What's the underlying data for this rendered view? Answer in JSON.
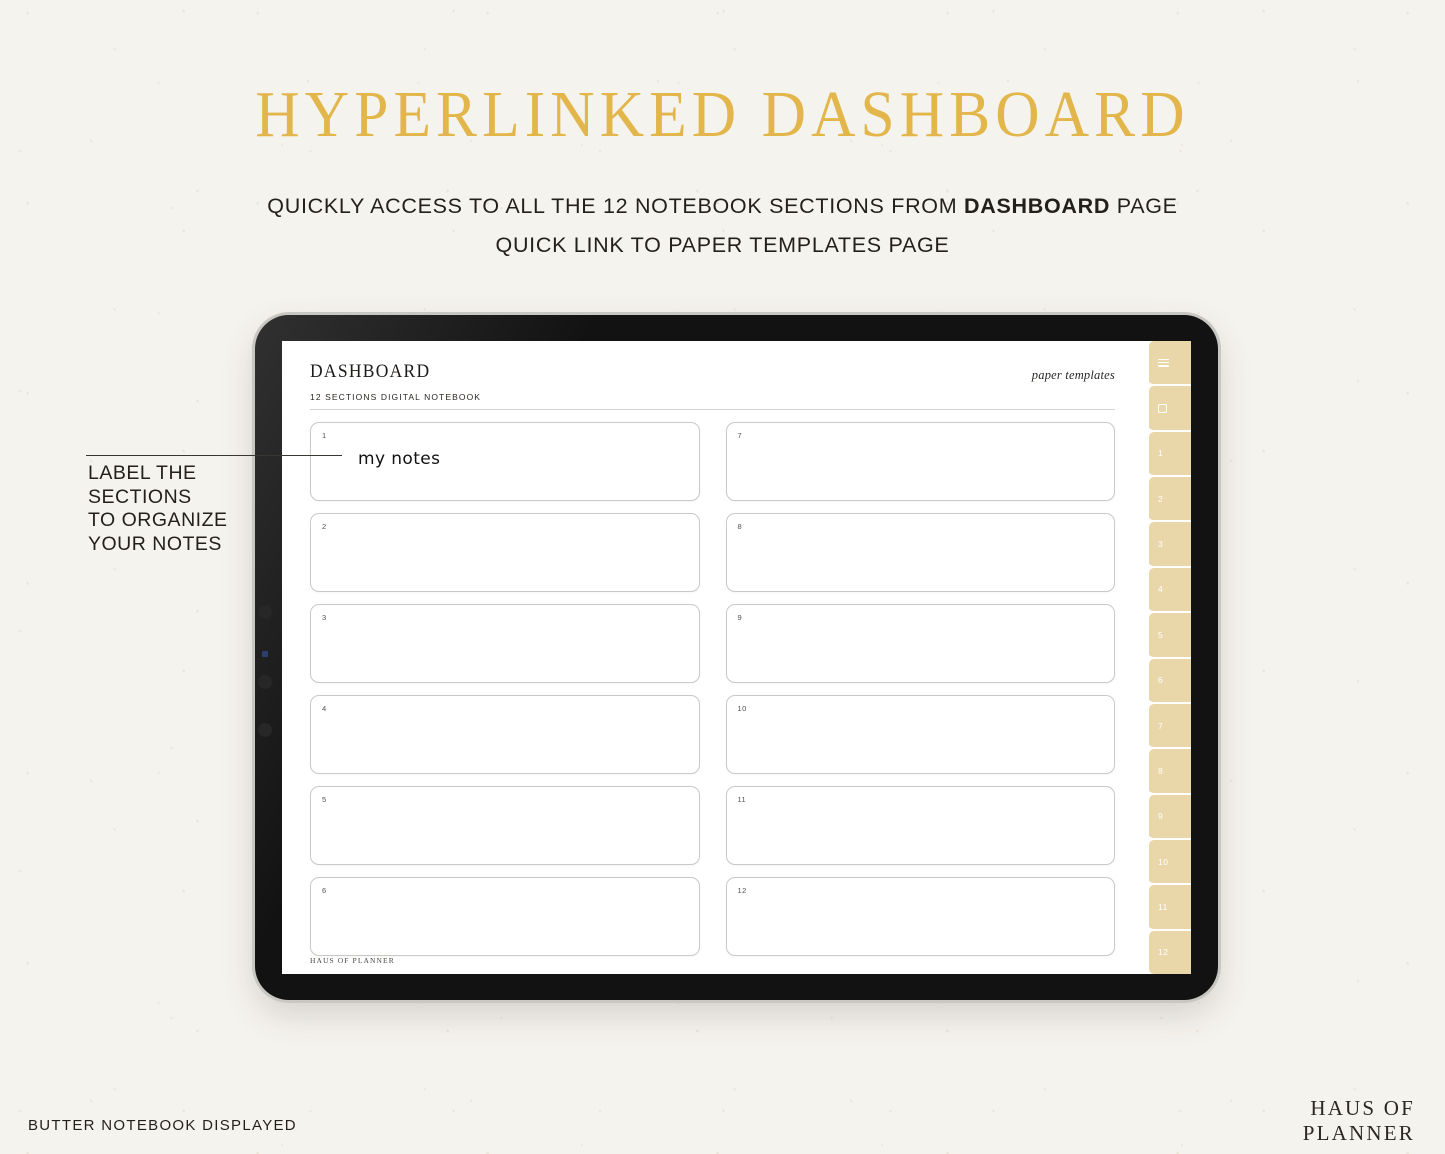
{
  "masthead": {
    "title": "HYPERLINKED DASHBOARD",
    "subtitle_1_pre": "QUICKLY ACCESS TO ALL THE 12 NOTEBOOK SECTIONS FROM ",
    "subtitle_1_strong": "DASHBOARD",
    "subtitle_1_post": " PAGE",
    "subtitle_2": "QUICK LINK TO PAPER TEMPLATES PAGE"
  },
  "callout": {
    "text": "LABEL THE\nSECTIONS\nTO ORGANIZE\nYOUR NOTES"
  },
  "notebook": {
    "title": "DASHBOARD",
    "paper_templates_link": "paper templates",
    "subtitle": "12 SECTIONS DIGITAL NOTEBOOK",
    "footer": "HAUS OF PLANNER",
    "sections": [
      {
        "number": "1",
        "label": "my notes"
      },
      {
        "number": "2",
        "label": ""
      },
      {
        "number": "3",
        "label": ""
      },
      {
        "number": "4",
        "label": ""
      },
      {
        "number": "5",
        "label": ""
      },
      {
        "number": "6",
        "label": ""
      },
      {
        "number": "7",
        "label": ""
      },
      {
        "number": "8",
        "label": ""
      },
      {
        "number": "9",
        "label": ""
      },
      {
        "number": "10",
        "label": ""
      },
      {
        "number": "11",
        "label": ""
      },
      {
        "number": "12",
        "label": ""
      }
    ],
    "tabs": [
      {
        "icon": "hamburger-menu-icon",
        "label": ""
      },
      {
        "icon": "dashboard-home-icon",
        "label": ""
      },
      {
        "icon": "",
        "label": "1"
      },
      {
        "icon": "",
        "label": "2"
      },
      {
        "icon": "",
        "label": "3"
      },
      {
        "icon": "",
        "label": "4"
      },
      {
        "icon": "",
        "label": "5"
      },
      {
        "icon": "",
        "label": "6"
      },
      {
        "icon": "",
        "label": "7"
      },
      {
        "icon": "",
        "label": "8"
      },
      {
        "icon": "",
        "label": "9"
      },
      {
        "icon": "",
        "label": "10"
      },
      {
        "icon": "",
        "label": "11"
      },
      {
        "icon": "",
        "label": "12"
      }
    ]
  },
  "footer_note": "BUTTER NOTEBOOK DISPLAYED",
  "brand": {
    "line1": "HAUS OF",
    "line2": "PLANNER"
  },
  "colors": {
    "background": "#f5f3ed",
    "title_gold": "#e2b64a",
    "tab_butter": "#e9d6a9",
    "ink": "#231f1d",
    "device_black": "#121212"
  }
}
